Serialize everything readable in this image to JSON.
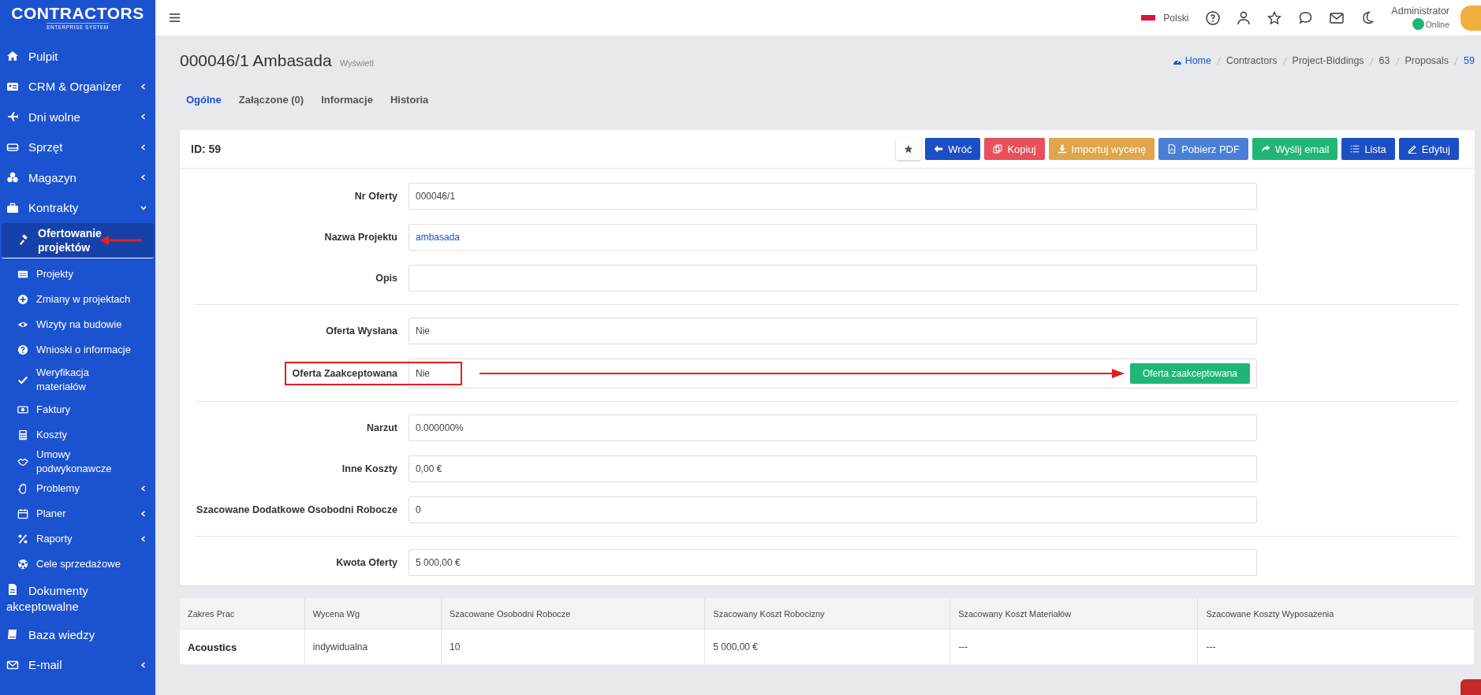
{
  "header": {
    "logo_title": "CONTRACTORS",
    "logo_subtitle": "ENTERPRISE SYSTEM",
    "language": "Polski",
    "user": "Administrator",
    "status": "Online"
  },
  "sidebar": {
    "items": [
      {
        "label": "Pulpit",
        "expandable": false
      },
      {
        "label": "CRM & Organizer",
        "expandable": true,
        "expanded": false
      },
      {
        "label": "Dni wolne",
        "expandable": true,
        "expanded": false
      },
      {
        "label": "Sprzęt",
        "expandable": true,
        "expanded": false
      },
      {
        "label": "Magazyn",
        "expandable": true,
        "expanded": false
      },
      {
        "label": "Kontrakty",
        "expandable": true,
        "expanded": true,
        "children": [
          {
            "label": "Ofertowanie projektów",
            "selected": true,
            "expandable": false
          },
          {
            "label": "Projekty",
            "selected": false,
            "expandable": false
          },
          {
            "label": "Zmiany w projektach",
            "selected": false,
            "expandable": false
          },
          {
            "label": "Wizyty na budowie",
            "selected": false,
            "expandable": false
          },
          {
            "label": "Wnioski o informacje",
            "selected": false,
            "expandable": false
          },
          {
            "label": "Weryfikacja materiałów",
            "selected": false,
            "expandable": false
          },
          {
            "label": "Faktury",
            "selected": false,
            "expandable": false
          },
          {
            "label": "Koszty",
            "selected": false,
            "expandable": false
          },
          {
            "label": "Umowy podwykonawcze",
            "selected": false,
            "expandable": false
          },
          {
            "label": "Problemy",
            "selected": false,
            "expandable": true
          },
          {
            "label": "Planer",
            "selected": false,
            "expandable": true
          },
          {
            "label": "Raporty",
            "selected": false,
            "expandable": true
          },
          {
            "label": "Cele sprzedażowe",
            "selected": false,
            "expandable": false
          }
        ]
      },
      {
        "label": "Dokumenty akceptowalne",
        "expandable": false
      },
      {
        "label": "Baza wiedzy",
        "expandable": false
      },
      {
        "label": "E-mail",
        "expandable": true,
        "expanded": false
      }
    ]
  },
  "page": {
    "title": "000046/1 Ambasada",
    "subtitle": "Wyświetl",
    "breadcrumb": [
      {
        "label": "Home",
        "link": true
      },
      {
        "label": "Contractors",
        "link": false
      },
      {
        "label": "Project-Biddings",
        "link": false
      },
      {
        "label": "63",
        "link": false
      },
      {
        "label": "Proposals",
        "link": false
      },
      {
        "label": "59",
        "link": true
      }
    ]
  },
  "tabs": [
    {
      "label": "Ogólne",
      "selected": true
    },
    {
      "label": "Załączone (0)",
      "selected": false
    },
    {
      "label": "Informacje",
      "selected": false
    },
    {
      "label": "Historia",
      "selected": false
    }
  ],
  "card": {
    "title": "ID: 59",
    "buttons": [
      {
        "label": "Wróć",
        "color": "#1c4fc4"
      },
      {
        "label": "Kopiuj",
        "color": "#e8505b"
      },
      {
        "label": "Importuj wycenę",
        "color": "#e0a64b"
      },
      {
        "label": "Pobierz PDF",
        "color": "#4a7fd6"
      },
      {
        "label": "Wyślij email",
        "color": "#1fb677"
      },
      {
        "label": "Lista",
        "color": "#1c4fc4"
      },
      {
        "label": "Edytuj",
        "color": "#1c4fc4"
      }
    ],
    "sections": [
      [
        {
          "label": "Nr Oferty",
          "value": "000046/1",
          "kind": "text"
        },
        {
          "label": "Nazwa Projektu",
          "value": "ambasada",
          "kind": "link"
        },
        {
          "label": "Opis",
          "kind": "text"
        }
      ],
      [
        {
          "label": "Oferta Wysłana",
          "value": "Nie",
          "kind": "text"
        },
        {
          "label": "Oferta Zaakceptowana",
          "value": "Nie",
          "kind": "action",
          "action": "Oferta zaakceptowana"
        }
      ],
      [
        {
          "label": "Narzut",
          "value": "0.000000%",
          "kind": "text"
        },
        {
          "label": "Inne Koszty",
          "value": "0,00 €",
          "kind": "text"
        },
        {
          "label": "Szacowane Dodatkowe Osobodni Robocze",
          "value": "0",
          "kind": "text"
        }
      ],
      [
        {
          "label": "Kwota Oferty",
          "value": "5 000,00 €",
          "kind": "text"
        }
      ]
    ]
  },
  "table": {
    "columns": [
      "Zakres Prac",
      "Wycena Wg",
      "Szacowane Osobodni Robocze",
      "Szacowany Koszt Robocizny",
      "Szacowany Koszt Materiałów",
      "Szacowane Koszty Wyposażenia"
    ],
    "rows": [
      [
        "Acoustics",
        "indywidualna",
        "10",
        "5 000,00 €",
        "---",
        "---"
      ]
    ]
  }
}
